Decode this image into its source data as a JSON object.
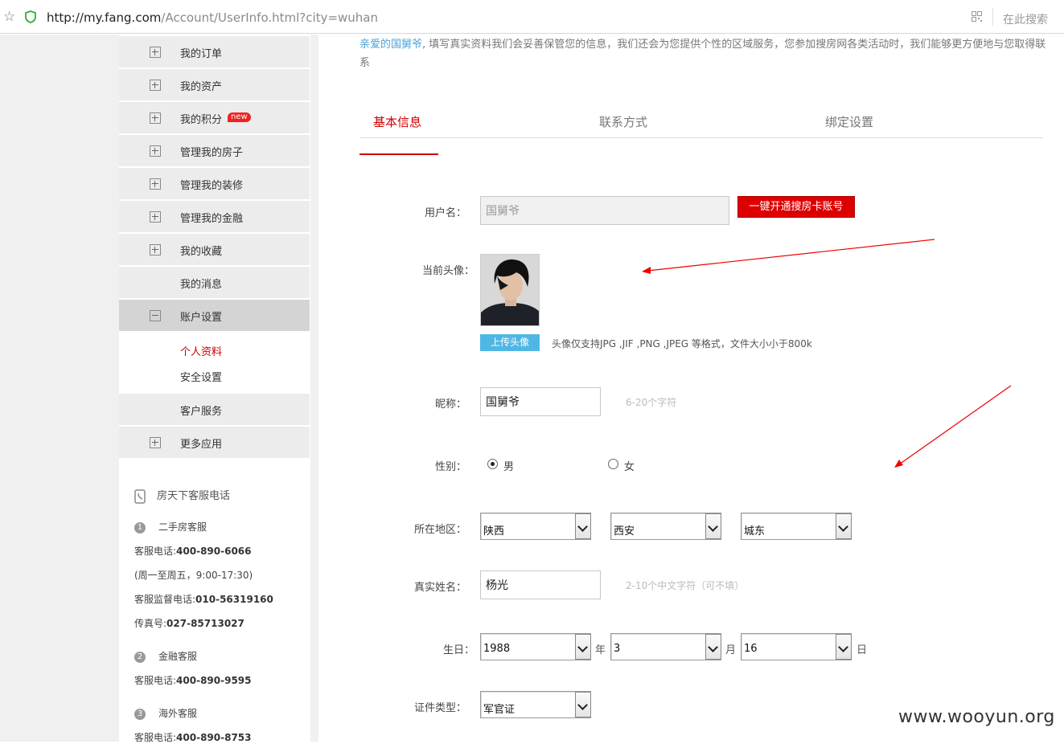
{
  "browser": {
    "url_host": "http://my.fang.com",
    "url_path": "/Account/UserInfo.html?city=wuhan",
    "search_placeholder": "在此搜索"
  },
  "sidebar": {
    "items": [
      {
        "label": "我的订单"
      },
      {
        "label": "我的资产"
      },
      {
        "label": "我的积分",
        "badge": "new"
      },
      {
        "label": "管理我的房子"
      },
      {
        "label": "管理我的装修"
      },
      {
        "label": "管理我的金融"
      },
      {
        "label": "我的收藏"
      },
      {
        "label": "我的消息"
      },
      {
        "label": "账户设置"
      },
      {
        "label": "客户服务"
      },
      {
        "label": "更多应用"
      }
    ],
    "sub_items": [
      {
        "label": "个人资料"
      },
      {
        "label": "安全设置"
      }
    ],
    "service": {
      "heading": "房天下客服电话",
      "groups": [
        {
          "num": "1",
          "title": "二手房客服",
          "line1_label": "客服电话:",
          "line1_value": "400-890-6066",
          "line2": "(周一至周五，9:00-17:30)",
          "line3_label": "客服监督电话:",
          "line3_value": "010-56319160",
          "line4_label": "传真号:",
          "line4_value": "027-85713027"
        },
        {
          "num": "2",
          "title": "金融客服",
          "line1_label": "客服电话:",
          "line1_value": "400-890-9595"
        },
        {
          "num": "3",
          "title": "海外客服",
          "line1_label": "客服电话:",
          "line1_value": "400-890-8753"
        }
      ]
    }
  },
  "intro": {
    "greeting": "亲爱的国舅爷",
    "text": ", 填写真实资料我们会妥善保管您的信息，我们还会为您提供个性的区域服务，您参加搜房网各类活动时，我们能够更方便地与您取得联系"
  },
  "tabs": [
    {
      "label": "基本信息"
    },
    {
      "label": "联系方式"
    },
    {
      "label": "绑定设置"
    }
  ],
  "form": {
    "username": {
      "label": "用户名：",
      "value": "国舅爷",
      "button": "一键开通搜房卡账号"
    },
    "avatar": {
      "label": "当前头像：",
      "upload_button": "上传头像",
      "hint": "头像仅支持JPG ,JIF ,PNG ,JPEG 等格式，文件大小小于800k"
    },
    "nickname": {
      "label": "昵称：",
      "value": "国舅爷",
      "hint": "6-20个字符"
    },
    "gender": {
      "label": "性别：",
      "options": [
        "男",
        "女"
      ],
      "selected": "男"
    },
    "region": {
      "label": "所在地区：",
      "province": "陕西",
      "city": "西安",
      "district": "城东"
    },
    "realname": {
      "label": "真实姓名：",
      "value": "杨光",
      "hint": "2-10个中文字符（可不填）"
    },
    "birthday": {
      "label": "生日：",
      "year": "1988",
      "year_unit": "年",
      "month": "3",
      "month_unit": "月",
      "day": "16",
      "day_unit": "日"
    },
    "id_type": {
      "label": "证件类型：",
      "value": "军官证"
    }
  },
  "watermark": "www.wooyun.org",
  "colors": {
    "accent_red": "#cc0000",
    "link_blue": "#4aa3d8",
    "upload_blue": "#4fb7e6"
  }
}
